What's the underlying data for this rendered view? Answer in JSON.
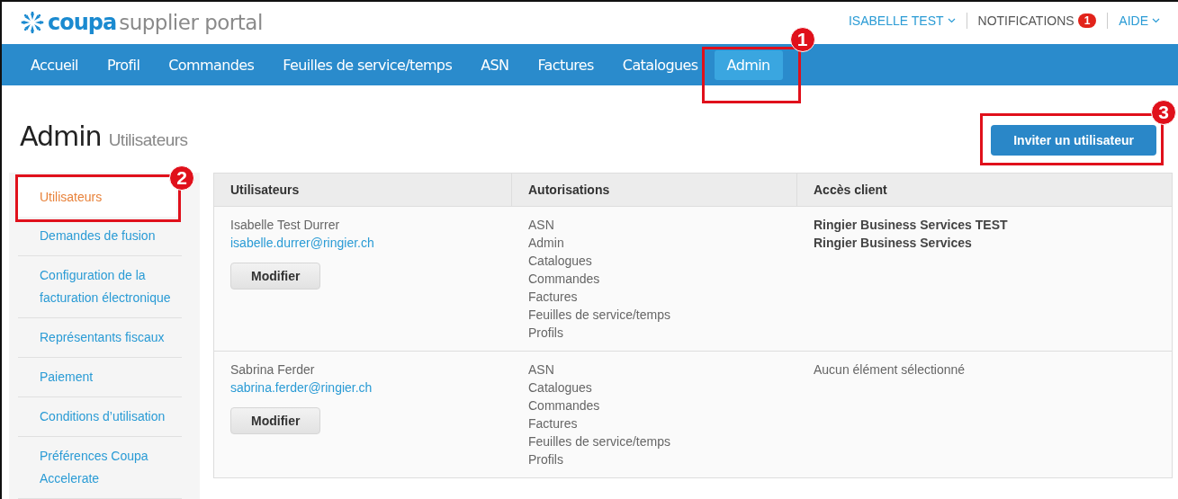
{
  "header": {
    "logo_brand": "coupa",
    "logo_product": "supplier portal",
    "user_menu": "ISABELLE TEST",
    "notifications": {
      "label": "NOTIFICATIONS",
      "count": "1"
    },
    "help_menu": "AIDE"
  },
  "nav": [
    {
      "label": "Accueil",
      "selected": false
    },
    {
      "label": "Profil",
      "selected": false
    },
    {
      "label": "Commandes",
      "selected": false
    },
    {
      "label": "Feuilles de service/temps",
      "selected": false
    },
    {
      "label": "ASN",
      "selected": false
    },
    {
      "label": "Factures",
      "selected": false
    },
    {
      "label": "Catalogues",
      "selected": false
    },
    {
      "label": "Admin",
      "selected": true,
      "callout": "1"
    }
  ],
  "page": {
    "title": "Admin",
    "subtitle": "Utilisateurs",
    "invite_button": {
      "label": "Inviter un utilisateur",
      "callout": "3"
    }
  },
  "sidebar": [
    {
      "label": "Utilisateurs",
      "selected": true,
      "callout": "2"
    },
    {
      "label": "Demandes de fusion",
      "selected": false
    },
    {
      "label": "Configuration de la facturation électronique",
      "selected": false
    },
    {
      "label": "Représentants fiscaux",
      "selected": false
    },
    {
      "label": "Paiement",
      "selected": false
    },
    {
      "label": "Conditions d’utilisation",
      "selected": false
    },
    {
      "label": "Préférences Coupa Accelerate",
      "selected": false
    }
  ],
  "table": {
    "columns": [
      "Utilisateurs",
      "Autorisations",
      "Accès client"
    ],
    "rows": [
      {
        "name": "Isabelle Test Durrer",
        "email": "isabelle.durrer@ringier.ch",
        "button": "Modifier",
        "permissions": [
          "ASN",
          "Admin",
          "Catalogues",
          "Commandes",
          "Factures",
          "Feuilles de service/temps",
          "Profils"
        ],
        "customers": [
          "Ringier Business Services TEST",
          "Ringier Business Services"
        ],
        "customers_empty": false
      },
      {
        "name": "Sabrina Ferder",
        "email": "sabrina.ferder@ringier.ch",
        "button": "Modifier",
        "permissions": [
          "ASN",
          "Catalogues",
          "Commandes",
          "Factures",
          "Feuilles de service/temps",
          "Profils"
        ],
        "customers": [
          "Aucun élément sélectionné"
        ],
        "customers_empty": true
      }
    ]
  }
}
